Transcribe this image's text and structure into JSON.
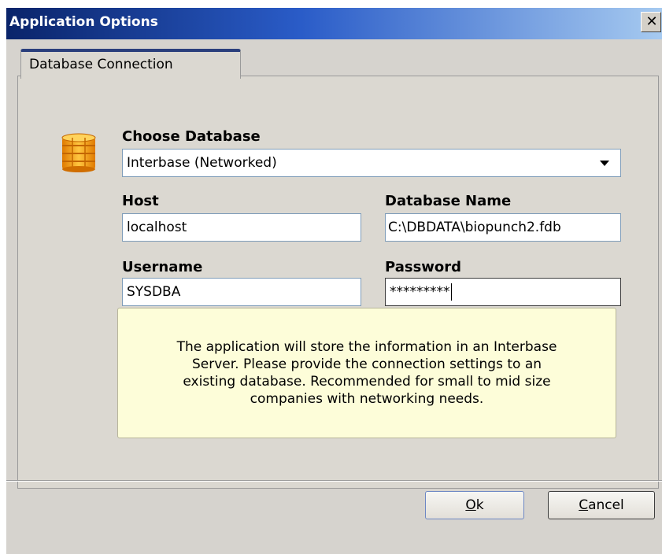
{
  "window": {
    "title": "Application Options",
    "close_glyph": "✕"
  },
  "tabs": [
    {
      "label": "Database Connection",
      "selected": true
    }
  ],
  "icons": {
    "database": "database-icon"
  },
  "form": {
    "choose_database_label": "Choose Database",
    "database_selected": "Interbase (Networked)",
    "host_label": "Host",
    "host_value": "localhost",
    "database_name_label": "Database Name",
    "database_name_value": "C:\\DBDATA\\biopunch2.fdb",
    "username_label": "Username",
    "username_value": "SYSDBA",
    "password_label": "Password",
    "password_value": "*********"
  },
  "info": {
    "lines": [
      "The application will store the information in an Interbase",
      "Server. Please provide the connection settings to an",
      "existing database. Recommended for small to mid size",
      "companies with networking needs."
    ]
  },
  "buttons": {
    "ok_mnemonic": "O",
    "ok_rest": "k",
    "cancel_mnemonic": "C",
    "cancel_rest": "ancel"
  },
  "colors": {
    "title_bar_start": "#0a246a",
    "title_bar_end": "#a6caf0",
    "dialog_background": "#d6d3ce",
    "info_background": "#fdfdd9",
    "icon_orange": "#f5a623"
  }
}
